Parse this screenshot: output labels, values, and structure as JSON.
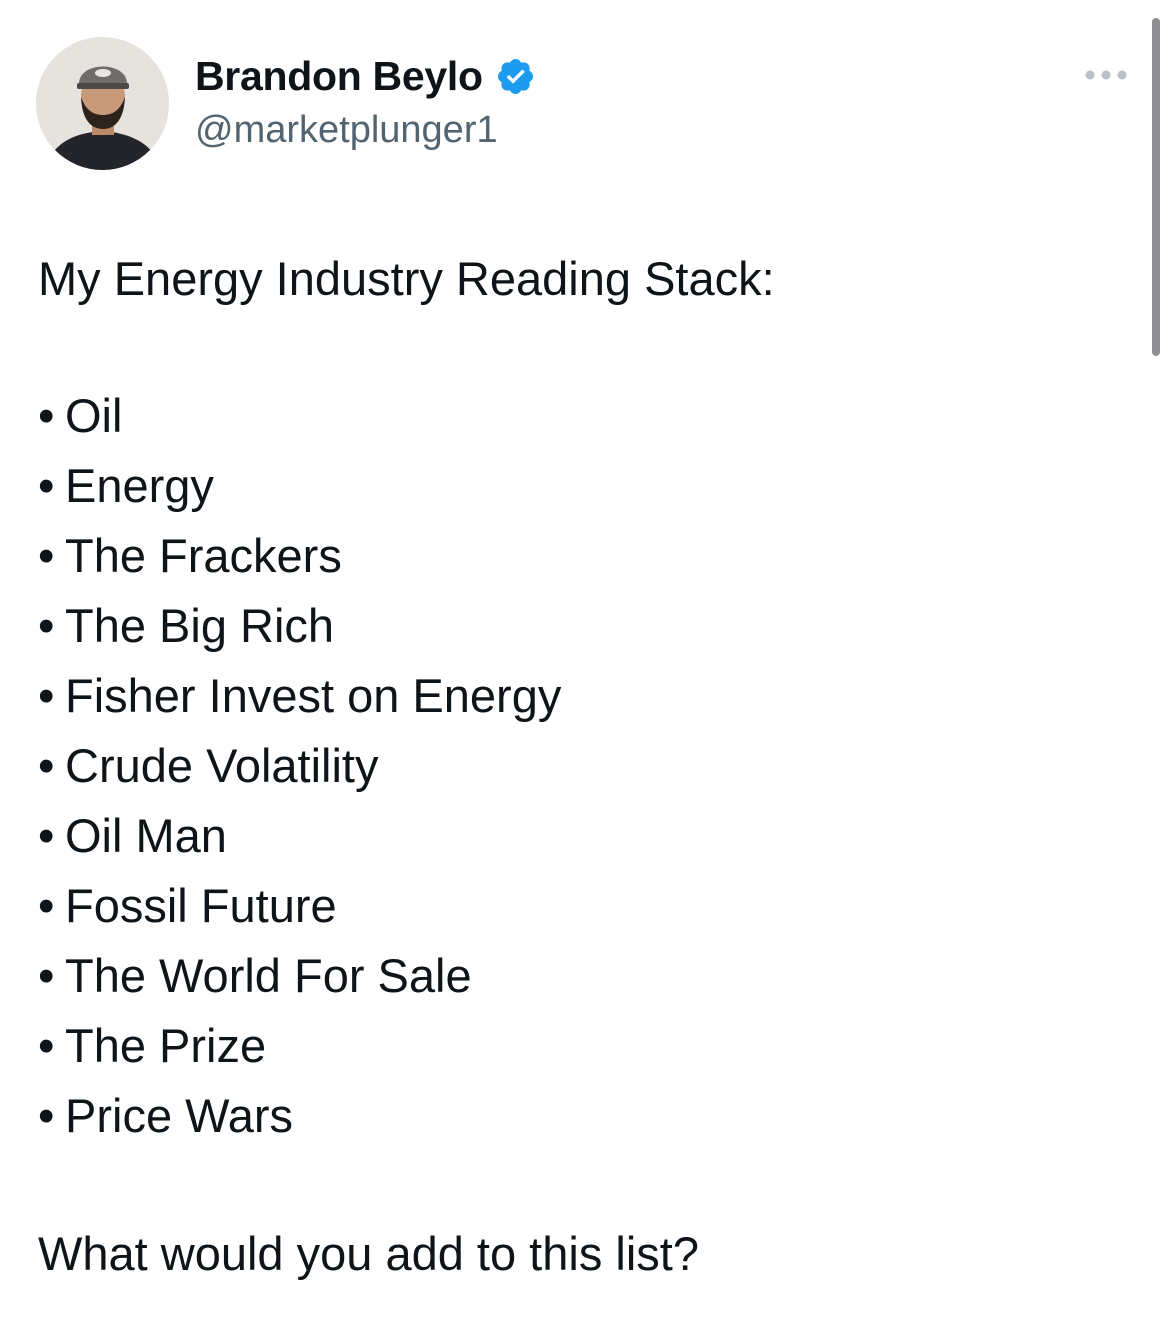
{
  "author": {
    "display_name": "Brandon Beylo",
    "handle": "@marketplunger1",
    "verified": true,
    "verified_color": "#1d9bf0"
  },
  "post": {
    "intro": "My Energy Industry Reading Stack:",
    "bullet": "•",
    "books": [
      "Oil",
      "Energy",
      "The Frackers",
      "The Big Rich",
      "Fisher Invest on Energy",
      "Crude Volatility",
      "Oil Man",
      "Fossil Future",
      "The World For Sale",
      "The Prize",
      "Price Wars"
    ],
    "question": "What would you add to this list?"
  },
  "icons": {
    "avatar": "profile-photo",
    "verified": "verified-badge-icon",
    "more": "more-options-icon"
  },
  "colors": {
    "text": "#0f1419",
    "secondary_text": "#536471",
    "background": "#ffffff"
  }
}
